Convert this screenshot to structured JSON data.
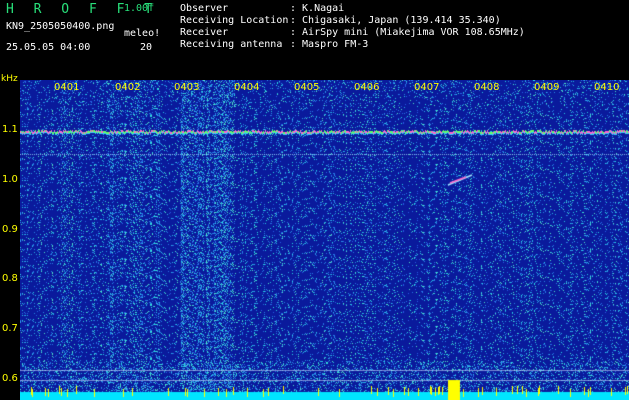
{
  "header": {
    "brand": "H R O F F T",
    "version": "1.00f",
    "filename": "KN9_2505050400.png",
    "meleo_label": "meleo!",
    "datetime": "25.05.05 04:00",
    "count": "20"
  },
  "meta": [
    {
      "label": "Observer",
      "value": ": K.Nagai"
    },
    {
      "label": "Receiving Location",
      "value": ": Chigasaki, Japan (139.414 35.340)"
    },
    {
      "label": "Receiver",
      "value": ": AirSpy mini (Miakejima VOR 108.65MHz)"
    },
    {
      "label": "Receiving antenna",
      "value": ": Maspro FM-3"
    }
  ],
  "axis": {
    "unit": "kHz",
    "time_labels": [
      "0401",
      "0402",
      "0403",
      "0404",
      "0405",
      "0406",
      "0407",
      "0408",
      "0409",
      "0410"
    ],
    "freq_labels": [
      "1.1",
      "1.0",
      "0.9",
      "0.8",
      "0.7",
      "0.6"
    ]
  },
  "colors": {
    "background": "#000000",
    "brand": "#28e07a",
    "axis_text": "#ffff00",
    "plot_bg": "#0a1a9c",
    "carrier": "#ff66cc",
    "baseline": "#00e5ff"
  }
}
